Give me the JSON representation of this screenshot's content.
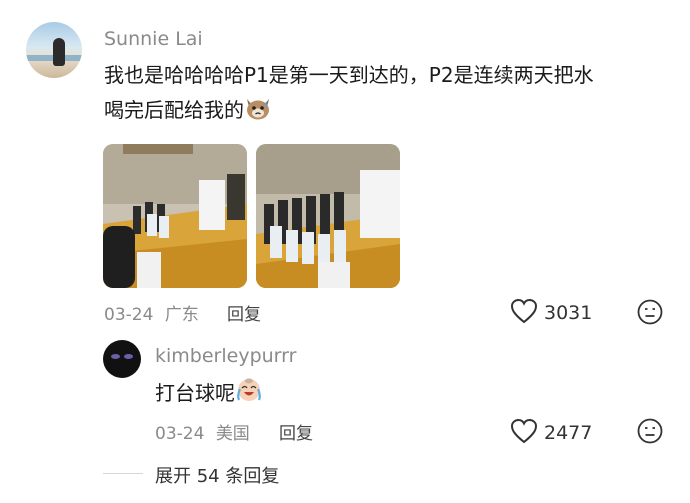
{
  "comments": [
    {
      "username": "Sunnie Lai",
      "text_line1": "我也是哈哈哈哈P1是第一天到达的，P2是连续两天把水",
      "text_line2": "喝完后配给我的",
      "emoji": "cat-sweat-emoji",
      "date": "03-24",
      "location": "广东",
      "reply_label": "回复",
      "like_count": "3031"
    },
    {
      "username": "kimberleypurrr",
      "text": "打台球呢",
      "emoji": "crying-laugh-emoji",
      "date": "03-24",
      "location": "美国",
      "reply_label": "回复",
      "like_count": "2477"
    }
  ],
  "expand_replies_label": "展开 54 条回复",
  "colors": {
    "meta_gray": "#8a8a8a",
    "text": "#1a1a1a"
  }
}
